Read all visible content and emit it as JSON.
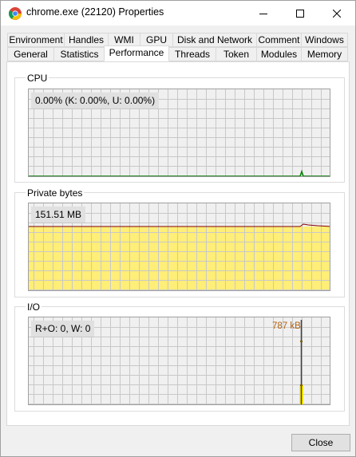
{
  "window": {
    "title": "chrome.exe (22120) Properties"
  },
  "tabs_row1": [
    "Environment",
    "Handles",
    "WMI",
    "GPU",
    "Disk and Network",
    "Comment",
    "Windows"
  ],
  "tabs_row2": [
    "General",
    "Statistics",
    "Performance",
    "Threads",
    "Token",
    "Modules",
    "Memory"
  ],
  "selected_tab": "Performance",
  "cpu": {
    "label": "CPU",
    "value_text": "0.00% (K: 0.00%, U: 0.00%)",
    "line_color": "#008000"
  },
  "private_bytes": {
    "label": "Private bytes",
    "value_text": "151.51 MB",
    "fill_color": "#ffee77",
    "line_color": "#800000"
  },
  "io": {
    "label": "I/O",
    "value_text": "R+O: 0, W: 0",
    "peak_label": "787 kB",
    "peak_label_color": "#b06010"
  },
  "close_button": {
    "label": "Close"
  },
  "colors": {
    "grid": "#c8c8c8",
    "graph_bg": "#f0f0f0"
  }
}
